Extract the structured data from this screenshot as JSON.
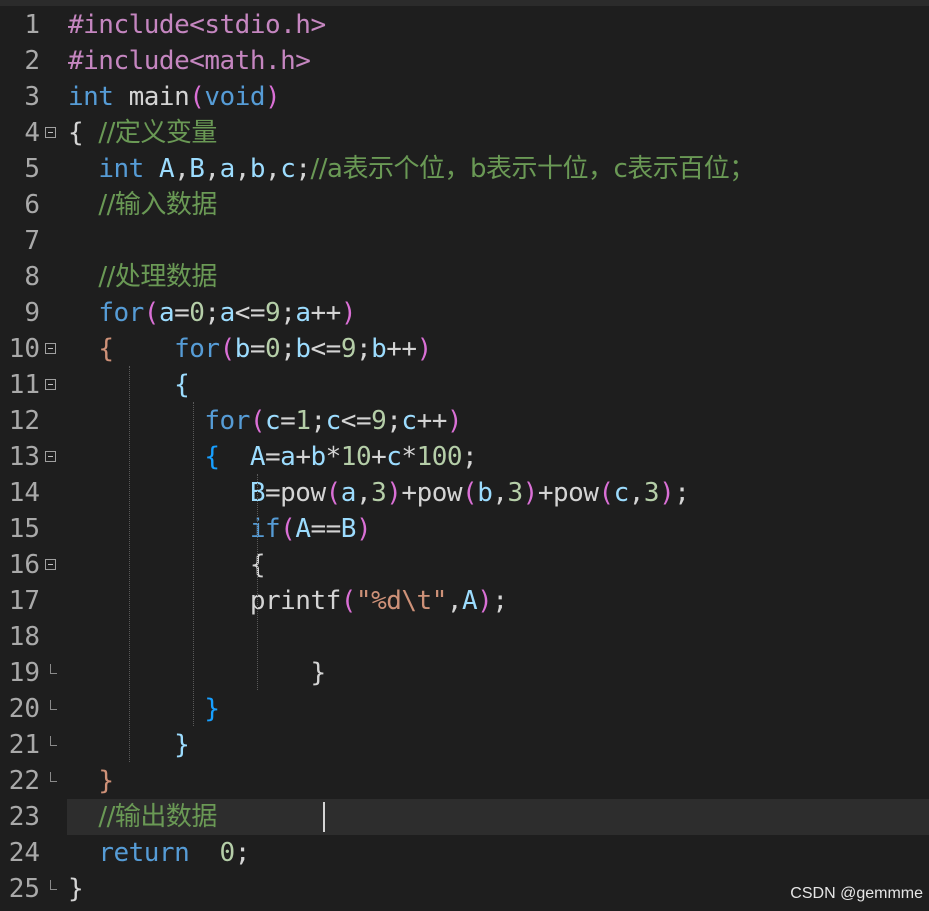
{
  "editor": {
    "lines": [
      {
        "n": "1",
        "tokens": [
          [
            "pre",
            "#include<stdio.h>"
          ]
        ]
      },
      {
        "n": "2",
        "tokens": [
          [
            "pre",
            "#include<math.h>"
          ]
        ]
      },
      {
        "n": "3",
        "tokens": [
          [
            "kw",
            "int"
          ],
          [
            "op",
            " "
          ],
          [
            "fn",
            "main"
          ],
          [
            "br2",
            "("
          ],
          [
            "kw",
            "void"
          ],
          [
            "br2",
            ")"
          ]
        ]
      },
      {
        "n": "4",
        "fold": "open",
        "tokens": [
          [
            "op",
            "{ "
          ],
          [
            "cm",
            "//定义变量"
          ]
        ]
      },
      {
        "n": "5",
        "tokens": [
          [
            "op",
            "  "
          ],
          [
            "kw",
            "int"
          ],
          [
            "op",
            " "
          ],
          [
            "id",
            "A"
          ],
          [
            "op",
            ","
          ],
          [
            "id",
            "B"
          ],
          [
            "op",
            ","
          ],
          [
            "id",
            "a"
          ],
          [
            "op",
            ","
          ],
          [
            "id",
            "b"
          ],
          [
            "op",
            ","
          ],
          [
            "id",
            "c"
          ],
          [
            "op",
            ";"
          ],
          [
            "cm",
            "//a表示个位，b表示十位，c表示百位；"
          ]
        ]
      },
      {
        "n": "6",
        "tokens": [
          [
            "op",
            "  "
          ],
          [
            "cm",
            "//输入数据"
          ]
        ]
      },
      {
        "n": "7",
        "tokens": []
      },
      {
        "n": "8",
        "tokens": [
          [
            "op",
            "  "
          ],
          [
            "cm",
            "//处理数据"
          ]
        ]
      },
      {
        "n": "9",
        "tokens": [
          [
            "op",
            "  "
          ],
          [
            "kw",
            "for"
          ],
          [
            "br2",
            "("
          ],
          [
            "id",
            "a"
          ],
          [
            "op",
            "="
          ],
          [
            "num",
            "0"
          ],
          [
            "op",
            ";"
          ],
          [
            "id",
            "a"
          ],
          [
            "op",
            "<="
          ],
          [
            "num",
            "9"
          ],
          [
            "op",
            ";"
          ],
          [
            "id",
            "a"
          ],
          [
            "op",
            "++"
          ],
          [
            "br2",
            ")"
          ]
        ]
      },
      {
        "n": "10",
        "fold": "open",
        "tokens": [
          [
            "op",
            "  "
          ],
          [
            "br4",
            "{"
          ],
          [
            "op",
            "    "
          ],
          [
            "kw",
            "for"
          ],
          [
            "br2",
            "("
          ],
          [
            "id",
            "b"
          ],
          [
            "op",
            "="
          ],
          [
            "num",
            "0"
          ],
          [
            "op",
            ";"
          ],
          [
            "id",
            "b"
          ],
          [
            "op",
            "<="
          ],
          [
            "num",
            "9"
          ],
          [
            "op",
            ";"
          ],
          [
            "id",
            "b"
          ],
          [
            "op",
            "++"
          ],
          [
            "br2",
            ")"
          ]
        ]
      },
      {
        "n": "11",
        "fold": "open",
        "tokens": [
          [
            "op",
            "       "
          ],
          [
            "id",
            "{"
          ]
        ]
      },
      {
        "n": "12",
        "tokens": [
          [
            "op",
            "         "
          ],
          [
            "kw",
            "for"
          ],
          [
            "br2",
            "("
          ],
          [
            "id",
            "c"
          ],
          [
            "op",
            "="
          ],
          [
            "num",
            "1"
          ],
          [
            "op",
            ";"
          ],
          [
            "id",
            "c"
          ],
          [
            "op",
            "<="
          ],
          [
            "num",
            "9"
          ],
          [
            "op",
            ";"
          ],
          [
            "id",
            "c"
          ],
          [
            "op",
            "++"
          ],
          [
            "br2",
            ")"
          ]
        ]
      },
      {
        "n": "13",
        "fold": "open",
        "tokens": [
          [
            "op",
            "         "
          ],
          [
            "br3",
            "{"
          ],
          [
            "op",
            "  "
          ],
          [
            "id",
            "A"
          ],
          [
            "op",
            "="
          ],
          [
            "id",
            "a"
          ],
          [
            "op",
            "+"
          ],
          [
            "id",
            "b"
          ],
          [
            "op",
            "*"
          ],
          [
            "num",
            "10"
          ],
          [
            "op",
            "+"
          ],
          [
            "id",
            "c"
          ],
          [
            "op",
            "*"
          ],
          [
            "num",
            "100"
          ],
          [
            "op",
            ";"
          ]
        ]
      },
      {
        "n": "14",
        "tokens": [
          [
            "op",
            "            "
          ],
          [
            "id",
            "B"
          ],
          [
            "op",
            "="
          ],
          [
            "fn",
            "pow"
          ],
          [
            "br2",
            "("
          ],
          [
            "id",
            "a"
          ],
          [
            "op",
            ","
          ],
          [
            "num",
            "3"
          ],
          [
            "br2",
            ")"
          ],
          [
            "op",
            "+"
          ],
          [
            "fn",
            "pow"
          ],
          [
            "br2",
            "("
          ],
          [
            "id",
            "b"
          ],
          [
            "op",
            ","
          ],
          [
            "num",
            "3"
          ],
          [
            "br2",
            ")"
          ],
          [
            "op",
            "+"
          ],
          [
            "fn",
            "pow"
          ],
          [
            "br2",
            "("
          ],
          [
            "id",
            "c"
          ],
          [
            "op",
            ","
          ],
          [
            "num",
            "3"
          ],
          [
            "br2",
            ")"
          ],
          [
            "op",
            ";"
          ]
        ]
      },
      {
        "n": "15",
        "tokens": [
          [
            "op",
            "            "
          ],
          [
            "kw",
            "if"
          ],
          [
            "br2",
            "("
          ],
          [
            "id",
            "A"
          ],
          [
            "op",
            "=="
          ],
          [
            "id",
            "B"
          ],
          [
            "br2",
            ")"
          ]
        ]
      },
      {
        "n": "16",
        "fold": "open",
        "tokens": [
          [
            "op",
            "            "
          ],
          [
            "op",
            "{"
          ]
        ]
      },
      {
        "n": "17",
        "tokens": [
          [
            "op",
            "            "
          ],
          [
            "fn",
            "printf"
          ],
          [
            "br2",
            "("
          ],
          [
            "str",
            "\"%d\\t\""
          ],
          [
            "op",
            ","
          ],
          [
            "id",
            "A"
          ],
          [
            "br2",
            ")"
          ],
          [
            "op",
            ";"
          ]
        ]
      },
      {
        "n": "18",
        "tokens": []
      },
      {
        "n": "19",
        "fold": "tick",
        "tokens": [
          [
            "op",
            "                "
          ],
          [
            "op",
            "}"
          ]
        ]
      },
      {
        "n": "20",
        "fold": "tick",
        "tokens": [
          [
            "op",
            "         "
          ],
          [
            "br3",
            "}"
          ]
        ]
      },
      {
        "n": "21",
        "fold": "tick",
        "tokens": [
          [
            "op",
            "       "
          ],
          [
            "id",
            "}"
          ]
        ]
      },
      {
        "n": "22",
        "fold": "tick",
        "tokens": [
          [
            "op",
            "  "
          ],
          [
            "br4",
            "}"
          ]
        ]
      },
      {
        "n": "23",
        "current": true,
        "tokens": [
          [
            "op",
            "  "
          ],
          [
            "cm",
            "//输出数据"
          ]
        ]
      },
      {
        "n": "24",
        "tokens": [
          [
            "op",
            "  "
          ],
          [
            "kw",
            "return"
          ],
          [
            "op",
            "  "
          ],
          [
            "num",
            "0"
          ],
          [
            "op",
            ";"
          ]
        ]
      },
      {
        "n": "25",
        "fold": "end",
        "tokens": [
          [
            "op",
            "}"
          ]
        ]
      }
    ]
  },
  "watermark": "CSDN @gemmme",
  "colors": {
    "background": "#1e1e1e",
    "keyword": "#569cd6",
    "preprocessor": "#c586c0",
    "comment": "#6a9955",
    "number": "#b5cea8",
    "string": "#ce9178"
  }
}
